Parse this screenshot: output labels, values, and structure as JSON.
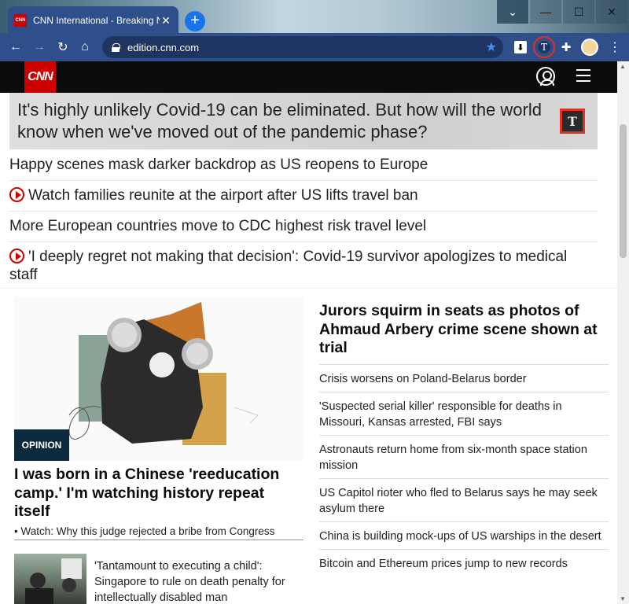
{
  "browser": {
    "tab_title": "CNN International - Breaking N",
    "favicon_text": "CNN",
    "tab_close": "✕",
    "new_tab": "+",
    "url": "edition.cnn.com",
    "window_controls": {
      "tabs": "⌄",
      "minimize": "—",
      "maximize": "☐",
      "close": "✕"
    },
    "nav": {
      "back": "←",
      "forward": "→",
      "reload": "↻",
      "home": "⌂"
    },
    "extensions": {
      "pocket": "⬇",
      "tts": "T",
      "puzzle": "✚",
      "menu": "⋮"
    }
  },
  "cnn": {
    "logo": "CNN",
    "hero_title": "It's highly unlikely Covid-19 can be eliminated. But how will the world know when we've moved out of the pandemic phase?",
    "tts_badge": "T",
    "headlines": [
      {
        "text": "Happy scenes mask darker backdrop as US reopens to Europe",
        "video": false
      },
      {
        "text": "Watch families reunite at the airport after US lifts travel ban",
        "video": true
      },
      {
        "text": "More European countries move to CDC highest risk travel level",
        "video": false
      },
      {
        "text": "'I deeply regret not making that decision': Covid-19 survivor apologizes to medical staff",
        "video": true
      }
    ],
    "feature": {
      "badge": "OPINION",
      "title": "I was born in a Chinese 'reeducation camp.' I'm watching history repeat itself",
      "sub": "• Watch: Why this judge rejected a bribe from Congress",
      "thumb_text": "'Tantamount to executing a child': Singapore to rule on death penalty for intellectually disabled man"
    },
    "right": {
      "title": "Jurors squirm in seats as photos of Ahmaud Arbery crime scene shown at trial",
      "items": [
        "Crisis worsens on Poland-Belarus border",
        "'Suspected serial killer' responsible for deaths in Missouri, Kansas arrested, FBI says",
        "Astronauts return home from six-month space station mission",
        "US Capitol rioter who fled to Belarus says he may seek asylum there",
        "China is building mock-ups of US warships in the desert",
        "Bitcoin and Ethereum prices jump to new records"
      ]
    }
  },
  "colors": {
    "chrome": "#2e4f8a",
    "cnn_red": "#cc0000",
    "cnn_black": "#0c0c0c",
    "highlight": "#e03020"
  }
}
